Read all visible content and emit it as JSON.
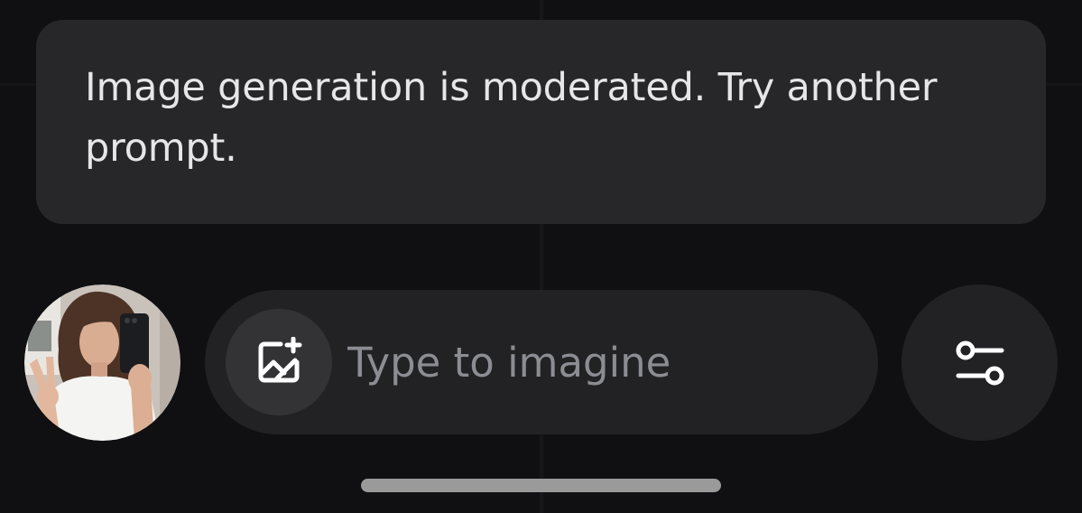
{
  "moderation_toast": {
    "message": "Image generation is moderated. Try another prompt."
  },
  "composer": {
    "avatar_icon": "user-selfie-photo",
    "add_image_icon": "image-plus-icon",
    "prompt": {
      "value": "",
      "placeholder": "Type to imagine"
    },
    "settings_icon": "sliders-toggle-icon"
  },
  "colors": {
    "background": "#101012",
    "toast_bg": "#27272a",
    "bar_bg": "#222225",
    "icon": "#ffffff",
    "placeholder": "#8b8d93"
  }
}
